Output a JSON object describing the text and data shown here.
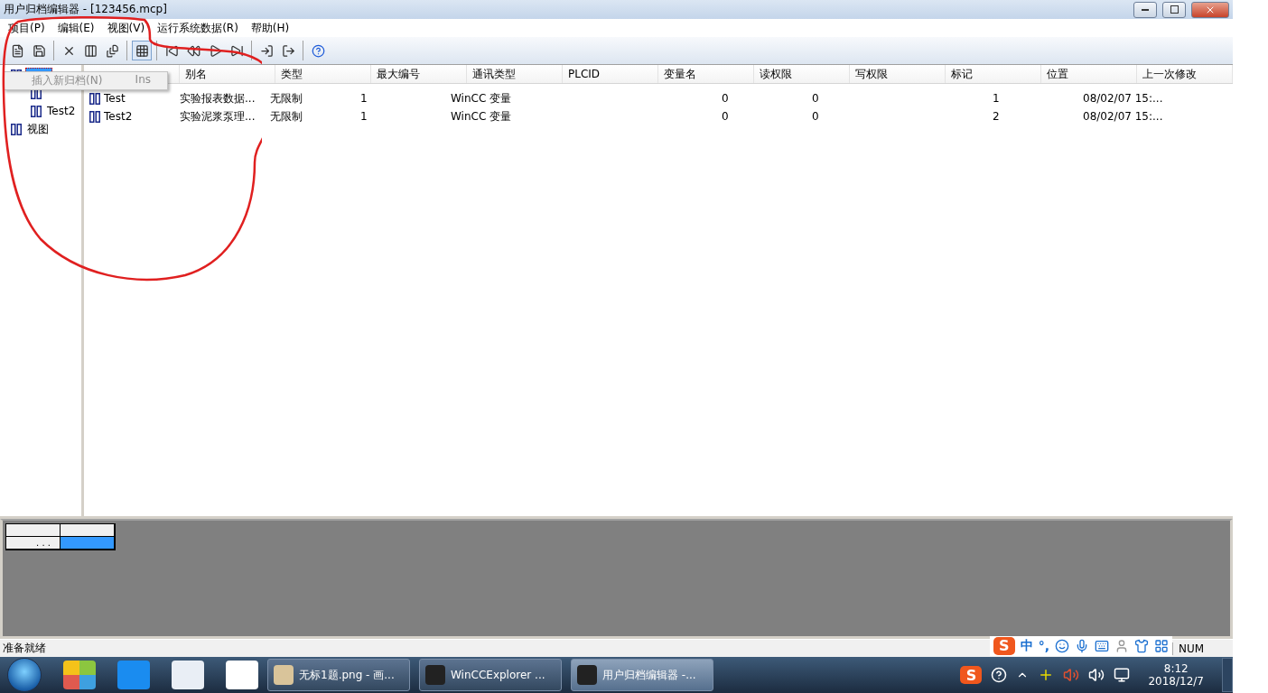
{
  "window": {
    "title": "用户归档编辑器 - [123456.mcp]"
  },
  "menu": [
    "项目(P)",
    "编辑(E)",
    "视图(V)",
    "运行系统数据(R)",
    "帮助(H)"
  ],
  "toolbar": [
    {
      "kind": "button",
      "pressed": false
    },
    {
      "kind": "button",
      "pressed": false
    },
    {
      "kind": "separator"
    },
    {
      "kind": "button",
      "pressed": false
    },
    {
      "kind": "button",
      "pressed": false
    },
    {
      "kind": "button",
      "pressed": false
    },
    {
      "kind": "separator"
    },
    {
      "kind": "button",
      "pressed": true
    },
    {
      "kind": "separator"
    },
    {
      "kind": "button",
      "pressed": false
    },
    {
      "kind": "button",
      "pressed": false
    },
    {
      "kind": "button",
      "pressed": false
    },
    {
      "kind": "button",
      "pressed": false
    },
    {
      "kind": "separator"
    },
    {
      "kind": "button",
      "pressed": false
    },
    {
      "kind": "button",
      "pressed": false
    },
    {
      "kind": "separator"
    },
    {
      "kind": "button",
      "pressed": false
    }
  ],
  "tree": [
    {
      "selected": true,
      "children": [
        {
          "selected": false
        },
        {
          "label": "Test2",
          "selected": false
        }
      ]
    },
    {
      "label": "视图",
      "selected": false
    }
  ],
  "context_menu": {
    "items": [
      {
        "label": "插入新归档(N)",
        "shortcut": "Ins",
        "disabled": true
      }
    ]
  },
  "table": {
    "columns": [
      "",
      "别名",
      "类型",
      "最大编号",
      "通讯类型",
      "PLCID",
      "变量名",
      "读权限",
      "写权限",
      "标记",
      "位置",
      "上一次修改"
    ],
    "rows": [
      {
        "cells": [
          "Test",
          "实验报表数据...",
          "无限制",
          "1",
          "WinCC 变量",
          "",
          "",
          "0",
          "0",
          "",
          "1",
          "08/02/07 15:..."
        ]
      },
      {
        "cells": [
          "Test2",
          "实验泥浆泵理...",
          "无限制",
          "1",
          "WinCC 变量",
          "",
          "",
          "0",
          "0",
          "",
          "2",
          "08/02/07 15:..."
        ]
      }
    ]
  },
  "preview_grid": {
    "rows": [
      {
        "cells": [
          {
            "selected": false
          },
          {
            "selected": false
          }
        ]
      },
      {
        "cells": [
          {
            "text": ". . .",
            "selected": false
          },
          {
            "selected": true
          }
        ]
      }
    ]
  },
  "status_bar": {
    "text": "准备就绪",
    "ime_logo": "S",
    "ime": [
      "中",
      "°,"
    ],
    "indicator": "NUM"
  },
  "taskbar": {
    "tasks": [
      {
        "label": "无标1题.png - 画...",
        "selected": false
      },
      {
        "label": "WinCCExplorer ...",
        "selected": false
      },
      {
        "label": "用户归档编辑器 -...",
        "selected": true
      }
    ],
    "tray_logo": "S",
    "clock": {
      "time": "8:12",
      "date": "2018/12/7"
    }
  }
}
